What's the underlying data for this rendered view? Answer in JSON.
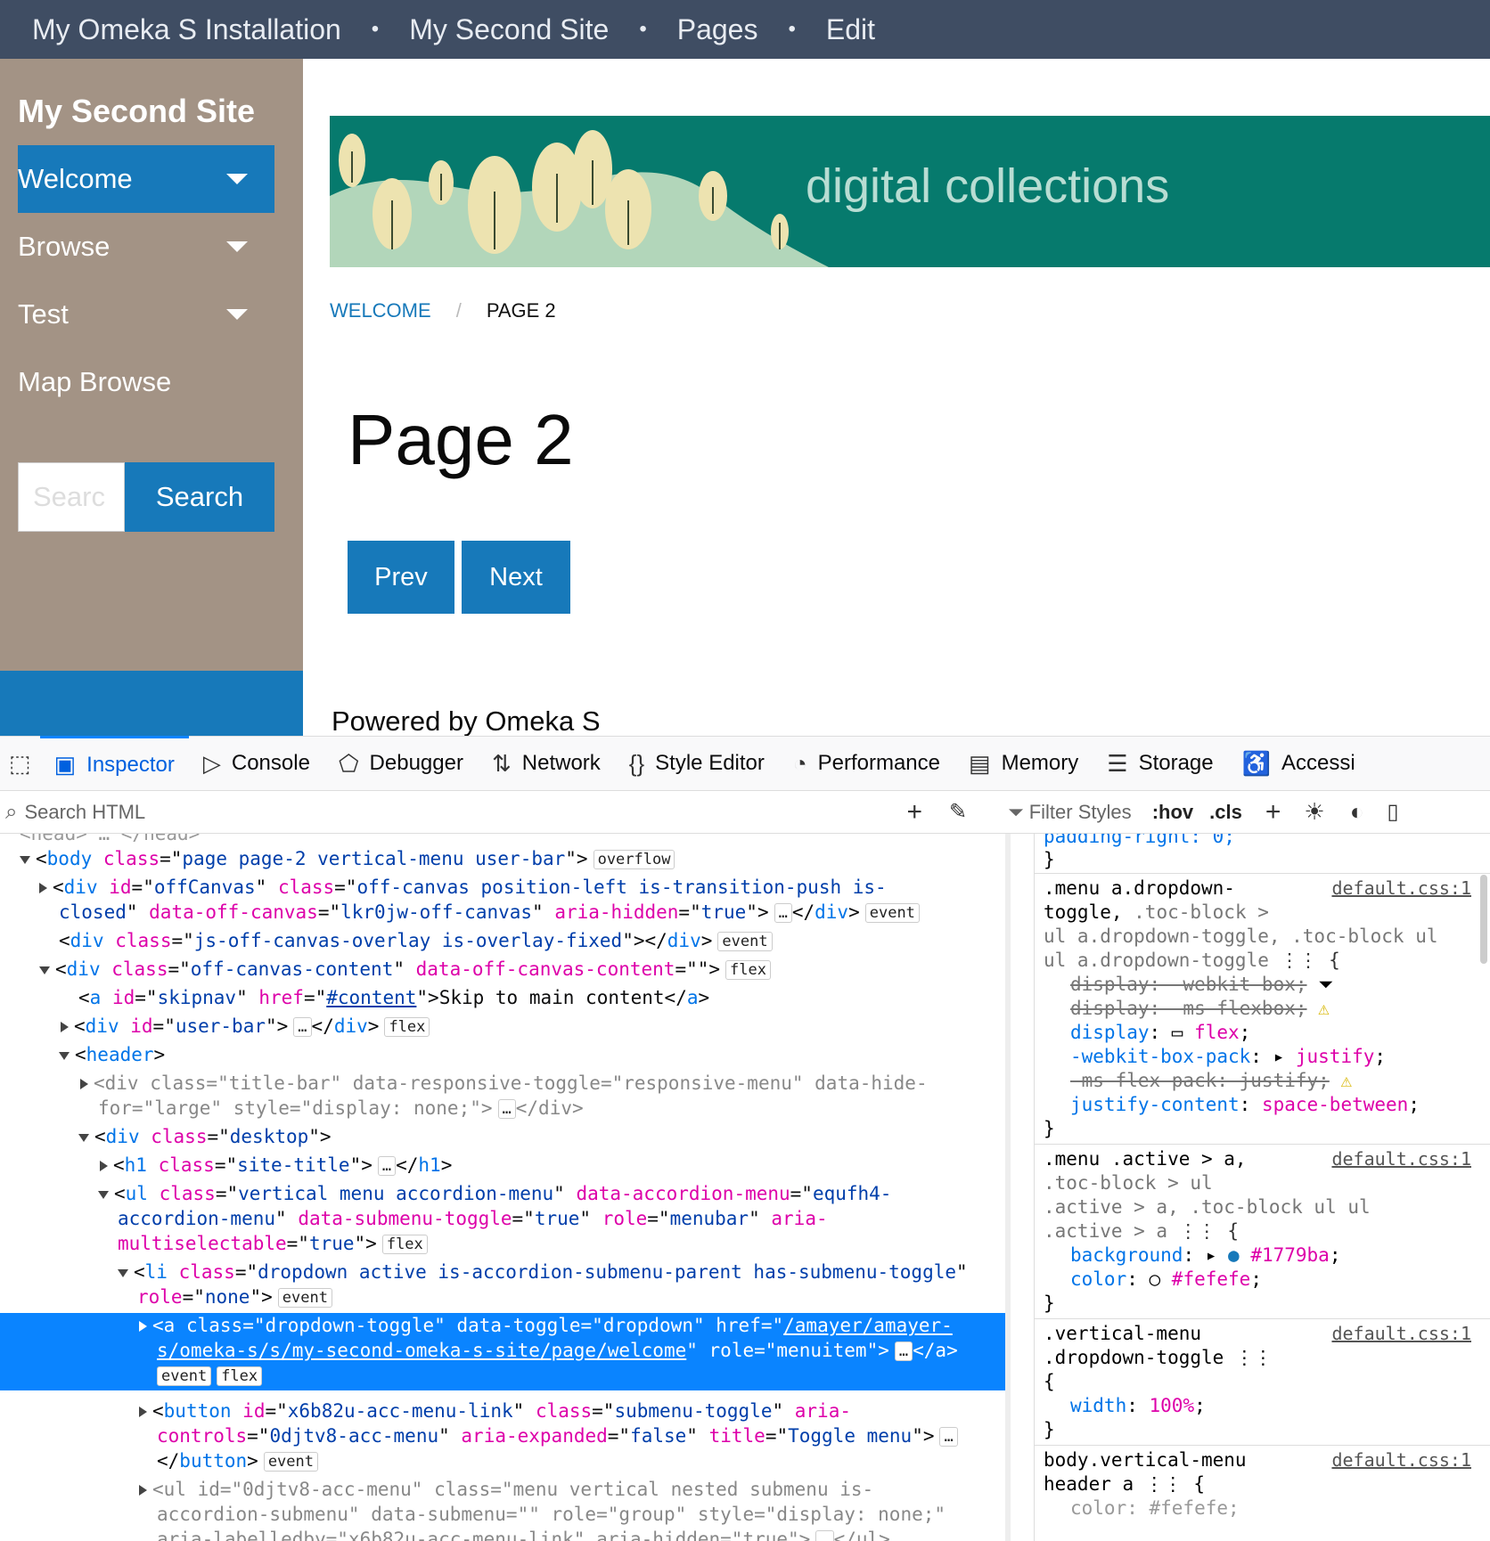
{
  "topbar": {
    "crumbs": [
      "My Omeka S Installation",
      "My Second Site",
      "Pages",
      "Edit"
    ],
    "separator": "•"
  },
  "sidebar": {
    "site_title": "My Second Site",
    "items": [
      {
        "label": "Welcome",
        "active": true,
        "has_caret": true
      },
      {
        "label": "Browse",
        "active": false,
        "has_caret": true
      },
      {
        "label": "Test",
        "active": false,
        "has_caret": true
      },
      {
        "label": "Map Browse",
        "active": false,
        "has_caret": false
      }
    ],
    "search_placeholder": "Searc",
    "search_button": "Search"
  },
  "banner": {
    "text": "digital collections"
  },
  "breadcrumbs": {
    "welcome": "WELCOME",
    "separator": "/",
    "current": "PAGE 2"
  },
  "page": {
    "title": "Page 2",
    "prev": "Prev",
    "next": "Next",
    "footer": "Powered by Omeka S"
  },
  "devtools": {
    "tabs": [
      {
        "label": "Inspector",
        "icon": "inspector-icon"
      },
      {
        "label": "Console",
        "icon": "console-icon"
      },
      {
        "label": "Debugger",
        "icon": "debugger-icon"
      },
      {
        "label": "Network",
        "icon": "network-icon"
      },
      {
        "label": "Style Editor",
        "icon": "style-editor-icon"
      },
      {
        "label": "Performance",
        "icon": "performance-icon"
      },
      {
        "label": "Memory",
        "icon": "memory-icon"
      },
      {
        "label": "Storage",
        "icon": "storage-icon"
      },
      {
        "label": "Accessi",
        "icon": "accessibility-icon"
      }
    ],
    "search_html_placeholder": "Search HTML",
    "filter_styles_placeholder": "Filter Styles",
    "hov": ":hov",
    "cls": ".cls"
  },
  "colors": {
    "accent": "#1779ba",
    "topbar": "#3f4d63",
    "sidebar": "#a39385",
    "banner": "#067a6d",
    "selection": "#0a84ff"
  }
}
